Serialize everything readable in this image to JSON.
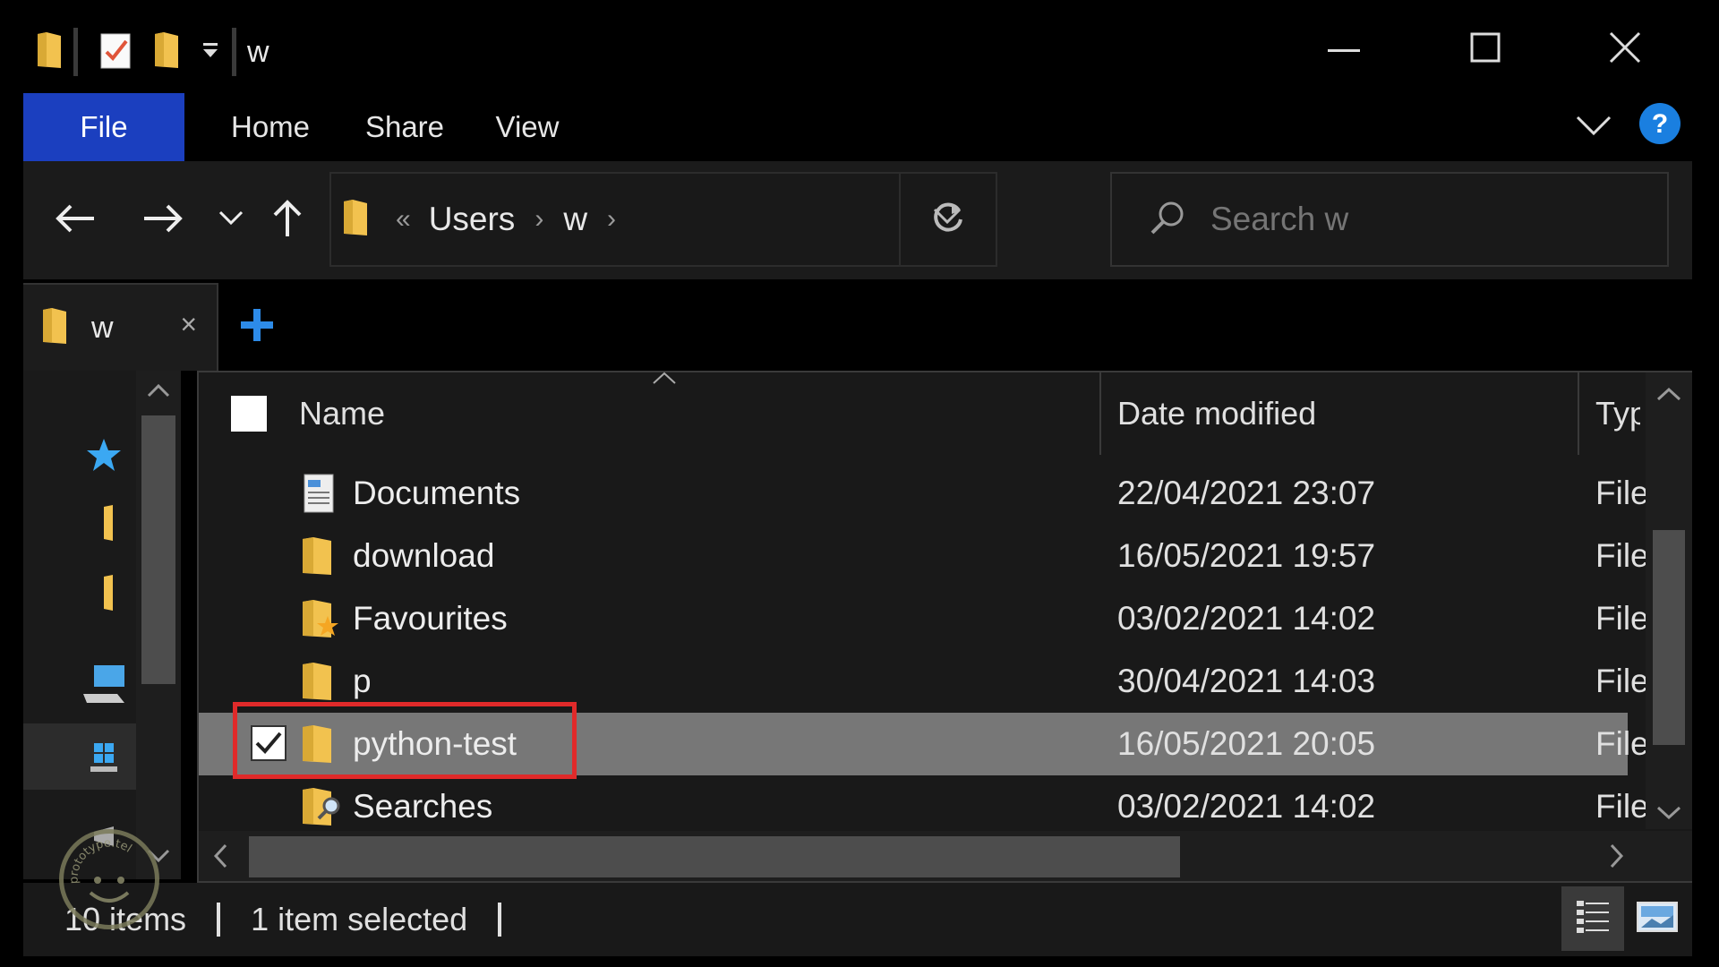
{
  "window": {
    "title": "w",
    "minimize_icon": "minimize-icon",
    "maximize_icon": "maximize-icon",
    "close_icon": "close-icon"
  },
  "quick_access": [
    "folder-icon",
    "properties-icon",
    "new-folder-icon",
    "customize-dropdown-icon"
  ],
  "ribbon": {
    "tabs": [
      "File",
      "Home",
      "Share",
      "View"
    ],
    "expand_icon": "chevron-down-icon",
    "help_icon": "help-icon"
  },
  "navigation": {
    "back_icon": "back-arrow-icon",
    "forward_icon": "forward-arrow-icon",
    "recent_icon": "recent-locations-icon",
    "up_icon": "up-arrow-icon"
  },
  "address": {
    "overflow": "«",
    "crumbs": [
      "Users",
      "w"
    ],
    "separator": "›",
    "dropdown_icon": "chevron-down-icon",
    "refresh_icon": "refresh-icon"
  },
  "search": {
    "placeholder": "Search w",
    "icon": "search-icon"
  },
  "tabs": {
    "current": "w",
    "close": "×",
    "new_tab_icon": "plus-icon"
  },
  "nav_pane": {
    "items": [
      "quick-access-star-icon",
      "folder-icon",
      "folder-icon",
      "this-pc-icon",
      "windows-drive-icon",
      "network-icon"
    ]
  },
  "file_list": {
    "columns": [
      "Name",
      "Date modified",
      "Typ"
    ],
    "sort_indicator": "^",
    "rows": [
      {
        "name": "Documents",
        "date": "22/04/2021 23:07",
        "type": "File",
        "icon": "documents-folder-icon",
        "selected": false
      },
      {
        "name": "download",
        "date": "16/05/2021 19:57",
        "type": "File",
        "icon": "folder-icon",
        "selected": false
      },
      {
        "name": "Favourites",
        "date": "03/02/2021 14:02",
        "type": "File",
        "icon": "favourites-folder-icon",
        "selected": false
      },
      {
        "name": "p",
        "date": "30/04/2021 14:03",
        "type": "File",
        "icon": "folder-icon",
        "selected": false
      },
      {
        "name": "python-test",
        "date": "16/05/2021 20:05",
        "type": "File",
        "icon": "folder-icon",
        "selected": true
      },
      {
        "name": "Searches",
        "date": "03/02/2021 14:02",
        "type": "File",
        "icon": "searches-folder-icon",
        "selected": false
      }
    ]
  },
  "status": {
    "item_count": "10 items",
    "selection": "1 item selected",
    "details_view_icon": "details-view-icon",
    "large_icons_view_icon": "large-icons-view-icon"
  },
  "watermark": {
    "text": "prototype.tel"
  },
  "colors": {
    "accent": "#1b3fbf",
    "highlight_border": "#e02a2a",
    "selected_row": "#777777",
    "folder": "#f2c24f"
  }
}
